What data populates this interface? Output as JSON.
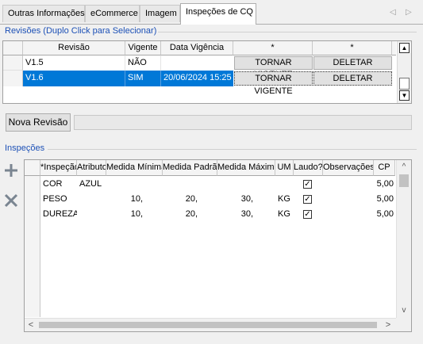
{
  "tabs": [
    {
      "label": "Outras Informações",
      "active": false
    },
    {
      "label": "eCommerce",
      "active": false
    },
    {
      "label": "Imagem",
      "active": false
    },
    {
      "label": "Inspeções de CQ",
      "active": true
    }
  ],
  "revisoes": {
    "title": "Revisões (Duplo Click para Selecionar)",
    "columns": [
      "Revisão",
      "Vigente",
      "Data Vigência",
      "*",
      "*"
    ],
    "rows": [
      {
        "revisao": "V1.5",
        "vigente": "NÃO",
        "data": "",
        "action1": "TORNAR VIGENTE",
        "action2": "DELETAR",
        "selected": false
      },
      {
        "revisao": "V1.6",
        "vigente": "SIM",
        "data": "20/06/2024 15:25",
        "action1": "TORNAR VIGENTE",
        "action2": "DELETAR",
        "selected": true
      }
    ],
    "new_button": "Nova Revisão"
  },
  "inspecoes": {
    "title": "Inspeções",
    "columns": [
      "*Inspeção",
      "Atributo",
      "Medida Mínima",
      "Medida Padrão",
      "Medida Máxima",
      "UM",
      "Laudo?",
      "Observações",
      "CP"
    ],
    "rows": [
      {
        "inspecao": "COR",
        "atributo": "AZUL",
        "min": "",
        "padrao": "",
        "max": "",
        "um": "",
        "laudo": true,
        "obs": "",
        "cp": "5,00"
      },
      {
        "inspecao": "PESO",
        "atributo": "",
        "min": "10,",
        "padrao": "20,",
        "max": "30,",
        "um": "KG",
        "laudo": true,
        "obs": "",
        "cp": "5,00"
      },
      {
        "inspecao": "DUREZA",
        "atributo": "",
        "min": "10,",
        "padrao": "20,",
        "max": "30,",
        "um": "KG",
        "laudo": true,
        "obs": "",
        "cp": "5,00"
      }
    ],
    "add_icon": "plus-icon",
    "remove_icon": "x-icon"
  },
  "colors": {
    "accent": "#1c50b6",
    "selection": "#0078d7"
  }
}
